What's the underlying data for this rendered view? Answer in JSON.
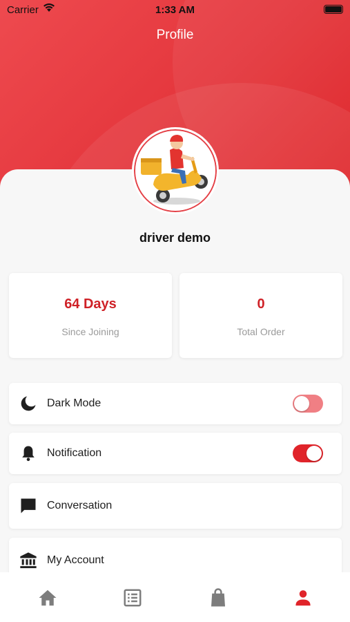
{
  "status_bar": {
    "carrier": "Carrier",
    "time": "1:33 AM"
  },
  "header": {
    "title": "Profile",
    "accent_color": "#e4363c"
  },
  "profile": {
    "name": "driver demo",
    "avatar_icon": "scooter-delivery-avatar"
  },
  "stats": [
    {
      "value": "64 Days",
      "label": "Since Joining"
    },
    {
      "value": "0",
      "label": "Total Order"
    }
  ],
  "menu": {
    "dark_mode": {
      "label": "Dark Mode",
      "icon": "moon-icon",
      "enabled": false
    },
    "notification": {
      "label": "Notification",
      "icon": "bell-icon",
      "enabled": true
    },
    "conversation": {
      "label": "Conversation",
      "icon": "chat-icon"
    },
    "my_account": {
      "label": "My Account",
      "icon": "bank-icon"
    }
  },
  "tabs": [
    {
      "name": "home",
      "icon": "home-icon",
      "active": false
    },
    {
      "name": "orders",
      "icon": "list-icon",
      "active": false
    },
    {
      "name": "shop",
      "icon": "bag-icon",
      "active": false
    },
    {
      "name": "profile",
      "icon": "person-icon",
      "active": true
    }
  ],
  "colors": {
    "active_tab": "#e0242a",
    "inactive_tab": "#7d7d7d"
  }
}
